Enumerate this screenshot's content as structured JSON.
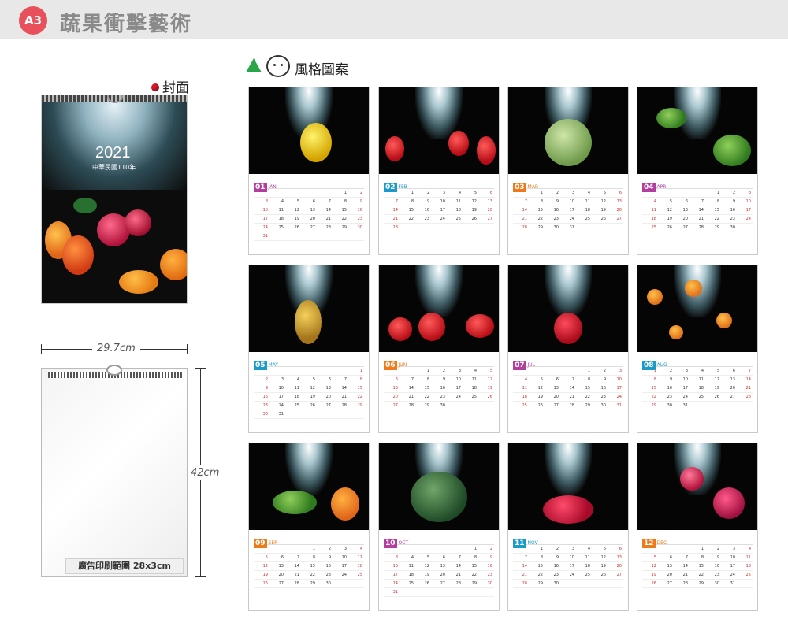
{
  "header": {
    "badge": "A3",
    "title": "蔬果衝擊藝術"
  },
  "cover": {
    "label": "封面",
    "year": "2021",
    "subtitle": "中華民國110年"
  },
  "blank": {
    "width_label": "29.7cm",
    "height_label": "42cm",
    "ad_area": "廣告印刷範圍 28x3cm"
  },
  "style_heading": "風格圖案",
  "months": [
    {
      "num": "01",
      "name": "JAN",
      "color": "#b43ea0",
      "offset": 5,
      "days": 31
    },
    {
      "num": "02",
      "name": "FEB",
      "color": "#1a9bc9",
      "offset": 1,
      "days": 28
    },
    {
      "num": "03",
      "name": "MAR",
      "color": "#f07a1a",
      "offset": 1,
      "days": 31
    },
    {
      "num": "04",
      "name": "APR",
      "color": "#b43ea0",
      "offset": 4,
      "days": 30
    },
    {
      "num": "05",
      "name": "MAY",
      "color": "#1a9bc9",
      "offset": 6,
      "days": 31
    },
    {
      "num": "06",
      "name": "JUN",
      "color": "#f07a1a",
      "offset": 2,
      "days": 30
    },
    {
      "num": "07",
      "name": "JUL",
      "color": "#b43ea0",
      "offset": 4,
      "days": 31
    },
    {
      "num": "08",
      "name": "AUG",
      "color": "#1a9bc9",
      "offset": 0,
      "days": 31
    },
    {
      "num": "09",
      "name": "SEP",
      "color": "#f07a1a",
      "offset": 3,
      "days": 30
    },
    {
      "num": "10",
      "name": "OCT",
      "color": "#b43ea0",
      "offset": 5,
      "days": 31
    },
    {
      "num": "11",
      "name": "NOV",
      "color": "#1a9bc9",
      "offset": 1,
      "days": 30
    },
    {
      "num": "12",
      "name": "DEC",
      "color": "#f07a1a",
      "offset": 3,
      "days": 31
    }
  ]
}
